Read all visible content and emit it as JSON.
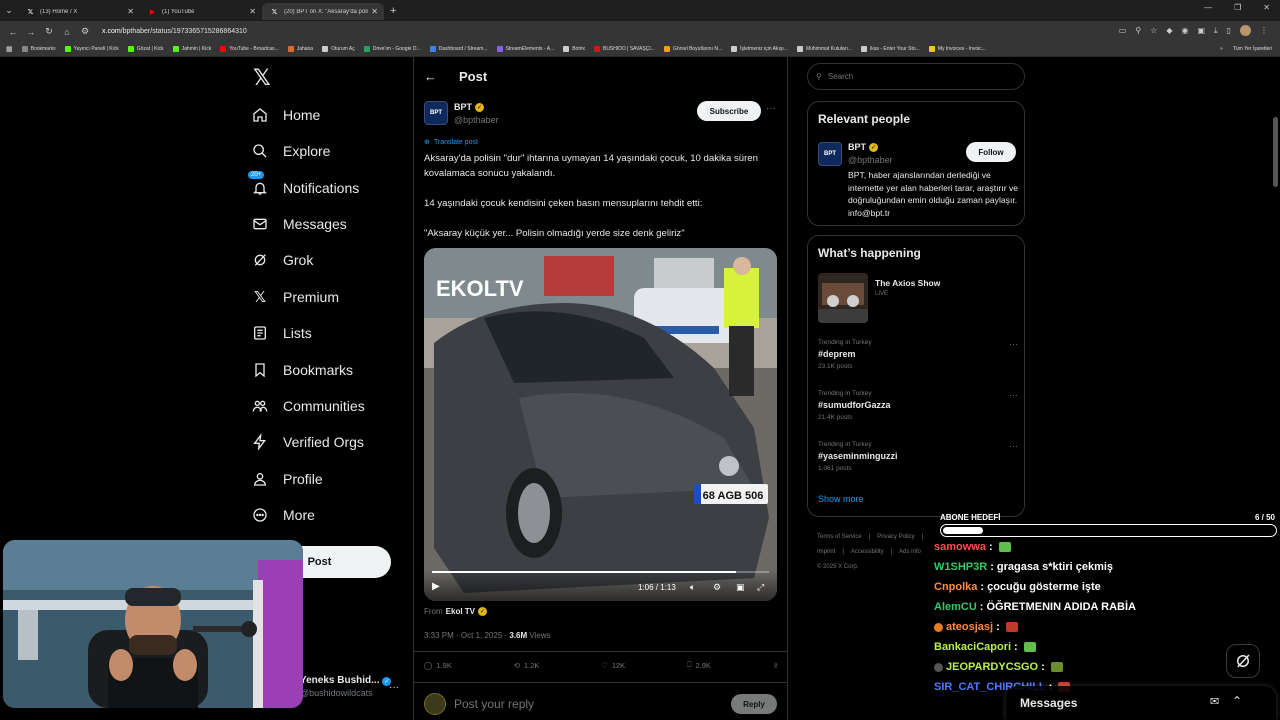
{
  "browser": {
    "tabs": [
      {
        "title": "(13) Home / X",
        "icon": "x-logo-icon",
        "active": false
      },
      {
        "title": "(1) YouTube",
        "icon": "youtube-icon",
        "active": false
      },
      {
        "title": "(20) BPT on X: \"Aksaray'da poli",
        "icon": "x-logo-icon",
        "active": true
      }
    ],
    "url_host": "x.com",
    "url_path": "/bpthaber/status/1973365715286864310",
    "bookmarks": [
      {
        "label": "Bookmarks",
        "color": "#888888"
      },
      {
        "label": "Yayıncı Paneli | Kick",
        "color": "#53fc18"
      },
      {
        "label": "Gözat | Kick",
        "color": "#53fc18"
      },
      {
        "label": "Jahmin | Kick",
        "color": "#53fc18"
      },
      {
        "label": "YouTube - Broadcas...",
        "color": "#ff0000"
      },
      {
        "label": "Jaharia",
        "color": "#e06a2b"
      },
      {
        "label": "Oturum Aç",
        "color": "#cccccc"
      },
      {
        "label": "Drive'ım - Google D...",
        "color": "#1fa463"
      },
      {
        "label": "Dashboard / Stream...",
        "color": "#3b82f6"
      },
      {
        "label": "StreamElements - A...",
        "color": "#8b5cf6"
      },
      {
        "label": "Botrix",
        "color": "#cccccc"
      },
      {
        "label": "BUSHIDO | SAVAŞÇI...",
        "color": "#d11"
      },
      {
        "label": "Görsel Boyutlarını N...",
        "color": "#f59e0b"
      },
      {
        "label": "İşletmeniz için Akışı...",
        "color": "#cccccc"
      },
      {
        "label": "Mühimmat Kutuları...",
        "color": "#cccccc"
      },
      {
        "label": "ikas - Enter Your Sto...",
        "color": "#cccccc"
      },
      {
        "label": "My Invoices - Invoic...",
        "color": "#f5c518"
      }
    ],
    "bookmarks_more": "»",
    "all_bookmarks": "Tüm Yer İşaretleri"
  },
  "nav": {
    "items": [
      {
        "label": "Home",
        "icon": "home-icon"
      },
      {
        "label": "Explore",
        "icon": "search-icon"
      },
      {
        "label": "Notifications",
        "icon": "bell-icon",
        "badge": "20+"
      },
      {
        "label": "Messages",
        "icon": "envelope-icon"
      },
      {
        "label": "Grok",
        "icon": "grok-icon"
      },
      {
        "label": "Premium",
        "icon": "x-logo-icon"
      },
      {
        "label": "Lists",
        "icon": "list-icon"
      },
      {
        "label": "Bookmarks",
        "icon": "bookmark-icon"
      },
      {
        "label": "Communities",
        "icon": "people-icon"
      },
      {
        "label": "Verified Orgs",
        "icon": "lightning-icon"
      },
      {
        "label": "Profile",
        "icon": "person-icon"
      },
      {
        "label": "More",
        "icon": "more-circle-icon"
      }
    ],
    "post_label": "Post",
    "account_name": "Yeneks Bushid...",
    "account_handle": "@bushidowildcats"
  },
  "post": {
    "header_title": "Post",
    "author_name": "BPT",
    "author_handle": "@bpthaber",
    "avatar_text": "BPT",
    "subscribe_label": "Subscribe",
    "translate_label": "Translate post",
    "paragraphs": [
      "Aksaray'da polisin \"dur\" ihtarına uymayan 14 yaşındaki çocuk, 10 dakika süren kovalamaca sonucu yakalandı.",
      "14 yaşındaki çocuk kendisini çeken basın mensuplarını tehdit etti:",
      "\"Aksaray küçük yer... Polisin olmadığı yerde size denk geliriz\""
    ],
    "video": {
      "watermark": "EKOLTV",
      "time": "1:06 / 1:13",
      "progress": 0.903,
      "plate": "68 AGB 506"
    },
    "from_label": "From",
    "from_source": "Ekol TV",
    "time": "3:33 PM · Oct 1, 2025 · ",
    "views_count": "3.6M",
    "views_label": " Views",
    "stats": {
      "replies": "1.9K",
      "reposts": "1.2K",
      "likes": "12K",
      "bookmarks": "2.9K"
    },
    "reply_placeholder": "Post your reply",
    "reply_label": "Reply"
  },
  "sidebar": {
    "search_placeholder": "Search",
    "relevant_title": "Relevant people",
    "relevant": {
      "name": "BPT",
      "handle": "@bpthaber",
      "bio": "BPT, haber ajanslarından derlediği ve internette yer alan haberleri tarar, araştırır ve doğruluğundan emin olduğu zaman paylaşır. info@bpt.tr",
      "follow_label": "Follow"
    },
    "happening_title": "What’s happening",
    "live": {
      "title": "The Axios Show",
      "status": "LIVE"
    },
    "trends": [
      {
        "context": "Trending in Turkey",
        "tag": "#deprem",
        "count": "23.1K posts"
      },
      {
        "context": "Trending in Turkey",
        "tag": "#sumudforGazza",
        "count": "21.4K posts"
      },
      {
        "context": "Trending in Turkey",
        "tag": "#yaseminminguzzi",
        "count": "1,061 posts"
      }
    ],
    "show_more": "Show more",
    "footer": [
      "Terms of Service",
      "|",
      "Privacy Policy",
      "|",
      "Imprint",
      "|",
      "Accessibility",
      "|",
      "Ads info",
      "© 2025 X Corp."
    ]
  },
  "overlay": {
    "abone_title": "ABONE HEDEFİ",
    "abone_count": "6 / 50",
    "abone_progress": 0.12,
    "chat": [
      {
        "user": "samowwa",
        "color": "#ff4d4d",
        "msg": "",
        "emote": "#5fbf4a"
      },
      {
        "user": "W1SHP3R",
        "color": "#33cc66",
        "msg": "gragasa s*ktiri çekmiş",
        "emote": ""
      },
      {
        "user": "Cnpolka",
        "color": "#ff8c42",
        "msg": "çocuğu gösterme işte",
        "emote": ""
      },
      {
        "user": "AlemCU",
        "color": "#33cc66",
        "msg": "ÖĞRETMENIN ADIDA RABİA",
        "emote": ""
      },
      {
        "user": "ateosjasj",
        "color": "#ff8c42",
        "msg": "",
        "emote": "#c0392b"
      },
      {
        "user": "BankaciCapori",
        "color": "#b8f050",
        "msg": "",
        "emote": "#5fbf4a"
      },
      {
        "user": "JEOPARDYCSGO",
        "color": "#b8f050",
        "msg": "",
        "emote": "#6a8f2a"
      },
      {
        "user": "SIR_CAT_CHIRCHILL",
        "color": "#4b7bff",
        "msg": "",
        "emote": "#c0392b"
      }
    ],
    "messages_label": "Messages"
  }
}
